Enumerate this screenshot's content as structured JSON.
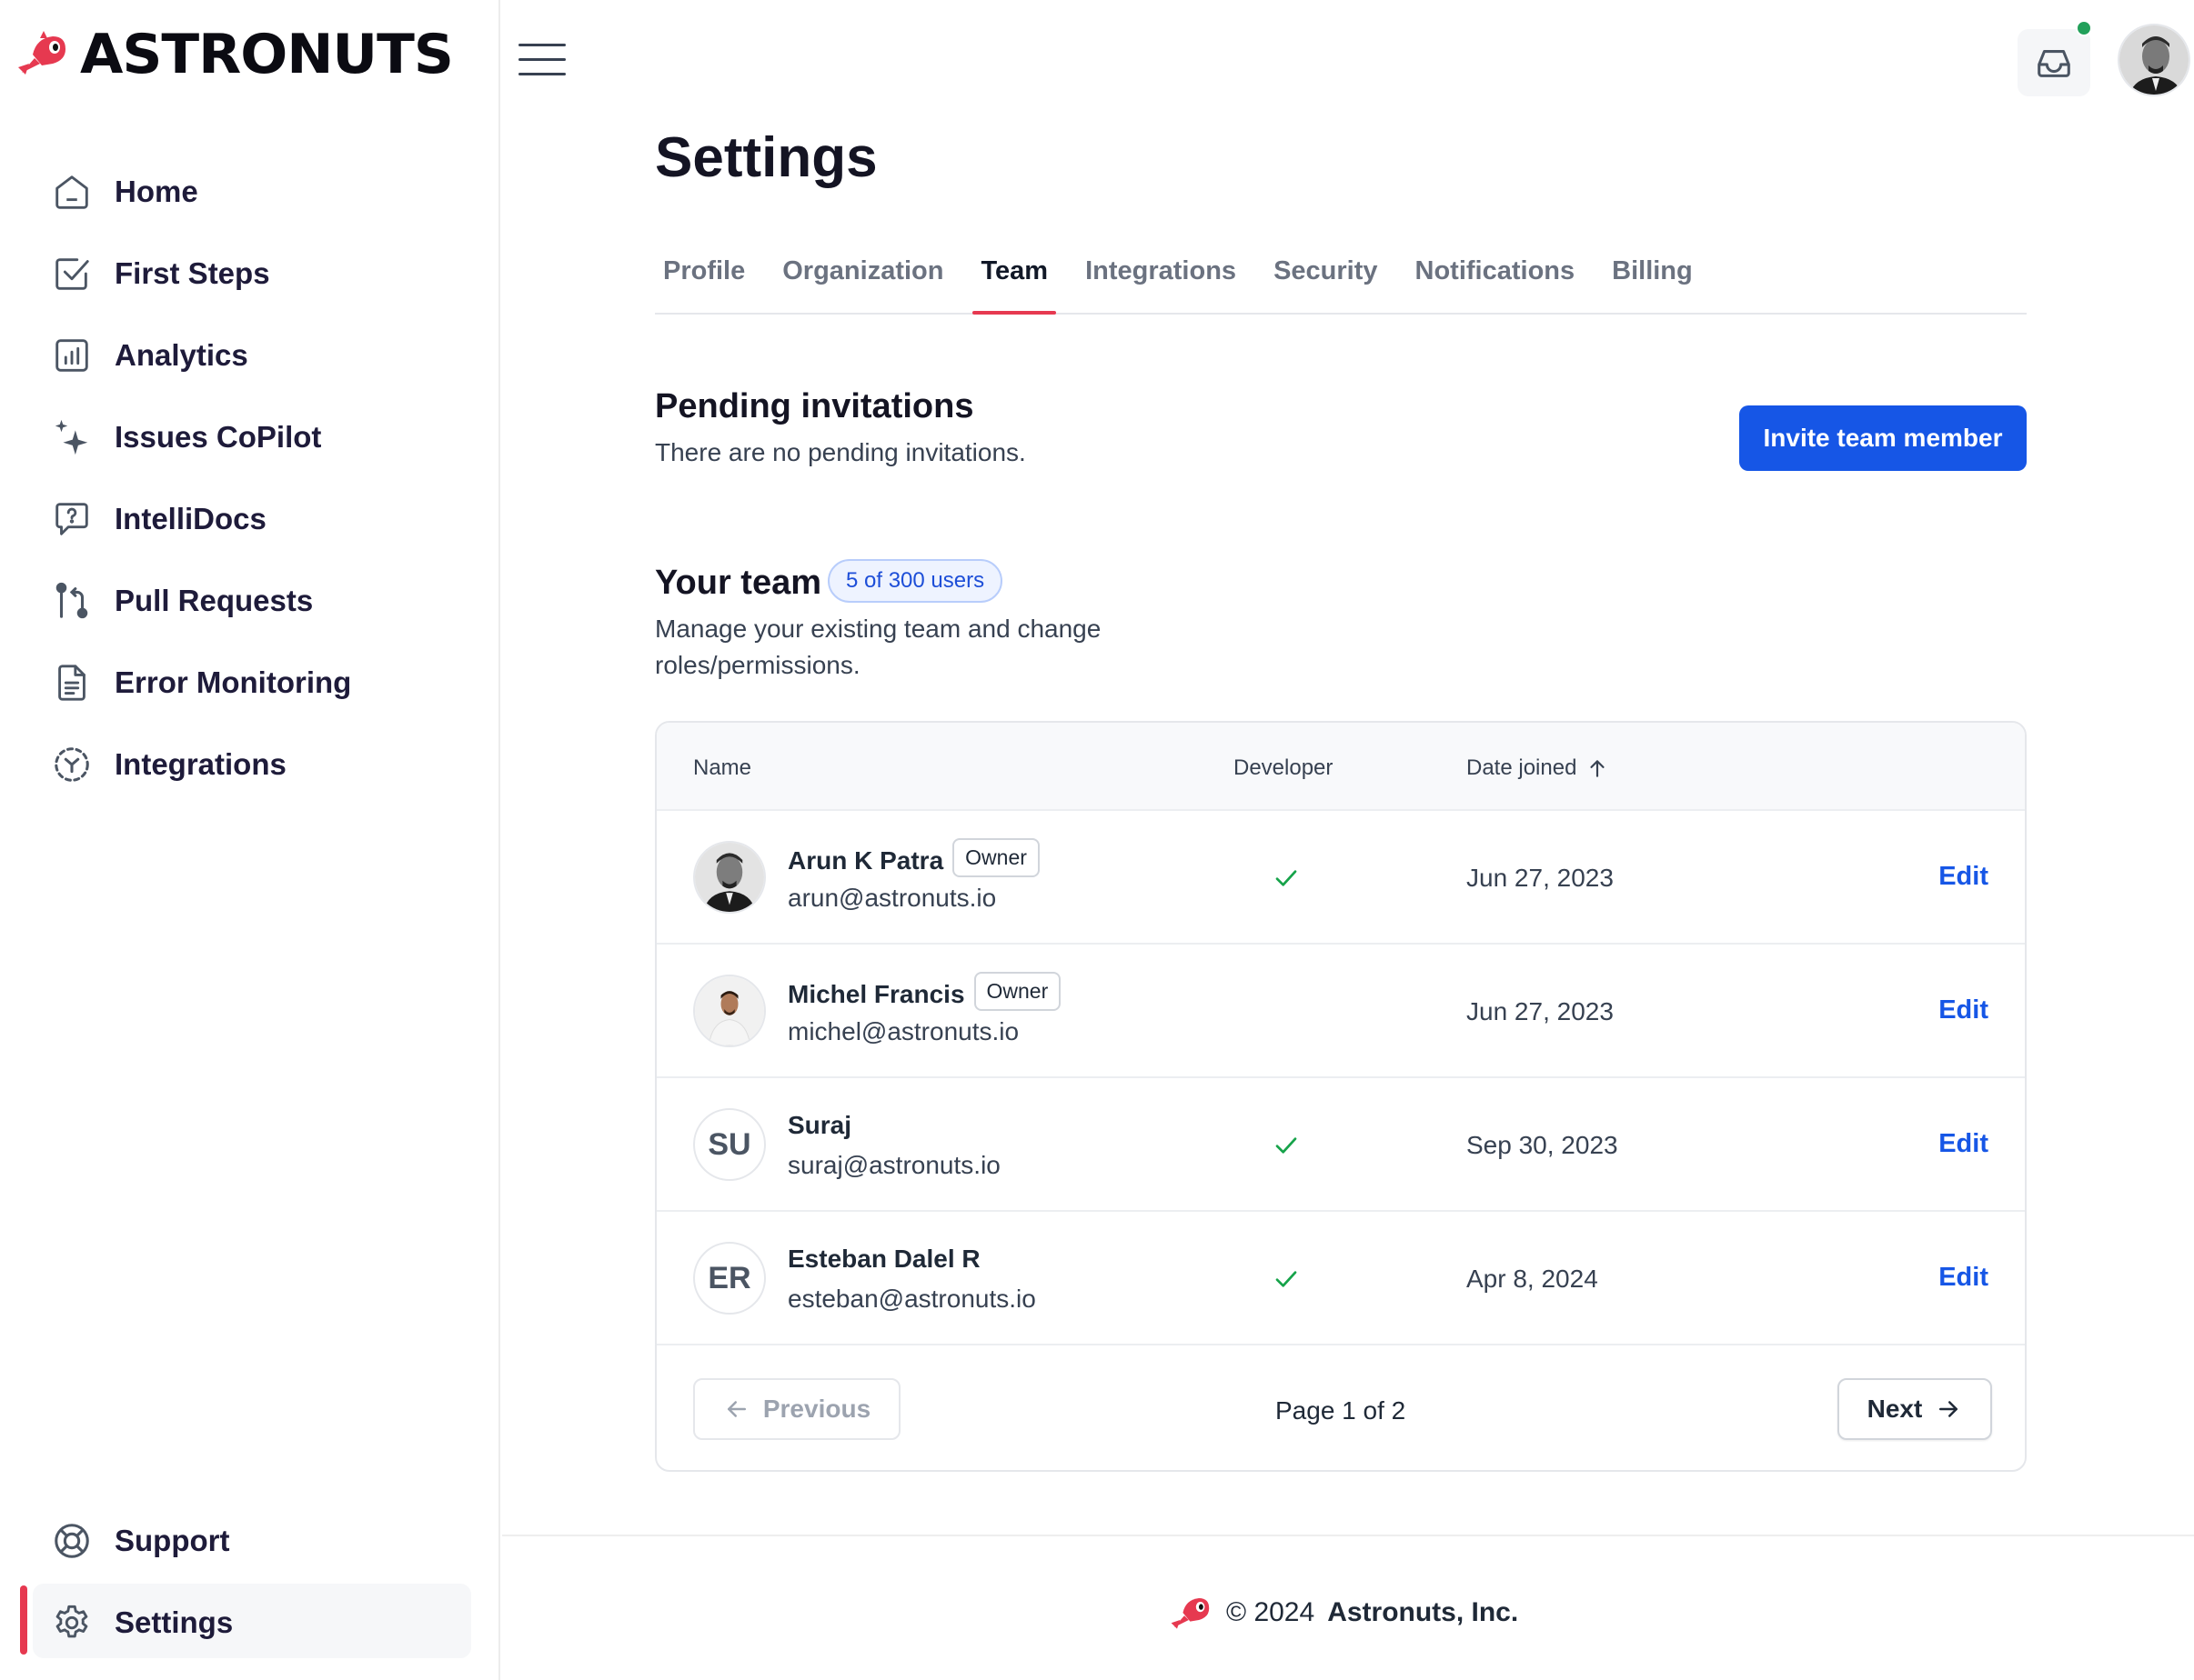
{
  "brand": {
    "name": "ASTRONUTS",
    "accent": "#e63950",
    "primary": "#1656e6"
  },
  "sidebar": {
    "items": [
      {
        "label": "Home",
        "icon": "home-icon"
      },
      {
        "label": "First Steps",
        "icon": "checkbox-icon"
      },
      {
        "label": "Analytics",
        "icon": "bar-chart-icon"
      },
      {
        "label": "Issues CoPilot",
        "icon": "sparkles-icon"
      },
      {
        "label": "IntelliDocs",
        "icon": "help-chat-icon"
      },
      {
        "label": "Pull Requests",
        "icon": "git-pull-request-icon"
      },
      {
        "label": "Error Monitoring",
        "icon": "document-icon"
      },
      {
        "label": "Integrations",
        "icon": "integrations-icon"
      }
    ],
    "bottom": [
      {
        "label": "Support",
        "icon": "lifebuoy-icon"
      },
      {
        "label": "Settings",
        "icon": "gear-icon",
        "active": true
      }
    ]
  },
  "page": {
    "title": "Settings"
  },
  "tabs": [
    "Profile",
    "Organization",
    "Team",
    "Integrations",
    "Security",
    "Notifications",
    "Billing"
  ],
  "active_tab": "Team",
  "pending": {
    "title": "Pending invitations",
    "subtitle": "There are no pending invitations.",
    "invite_label": "Invite team member"
  },
  "team": {
    "title": "Your team",
    "badge": "5 of 300 users",
    "subtitle": "Manage your existing team and change roles/permissions.",
    "columns": {
      "name": "Name",
      "developer": "Developer",
      "date": "Date joined"
    },
    "rows": [
      {
        "name": "Arun K Patra",
        "badge": "Owner",
        "email": "arun@astronuts.io",
        "developer": true,
        "date": "Jun 27, 2023",
        "action": "Edit",
        "avatar": "photo"
      },
      {
        "name": "Michel Francis",
        "badge": "Owner",
        "email": "michel@astronuts.io",
        "developer": false,
        "date": "Jun 27, 2023",
        "action": "Edit",
        "avatar": "photo"
      },
      {
        "name": "Suraj",
        "badge": "",
        "email": "suraj@astronuts.io",
        "developer": true,
        "date": "Sep 30, 2023",
        "action": "Edit",
        "initials": "SU"
      },
      {
        "name": "Esteban Dalel R",
        "badge": "",
        "email": "esteban@astronuts.io",
        "developer": true,
        "date": "Apr 8, 2024",
        "action": "Edit",
        "initials": "ER"
      }
    ],
    "pager": {
      "previous": "Previous",
      "info": "Page 1 of 2",
      "next": "Next"
    }
  },
  "footer": {
    "copyright": "© 2024",
    "company": "Astronuts, Inc."
  }
}
